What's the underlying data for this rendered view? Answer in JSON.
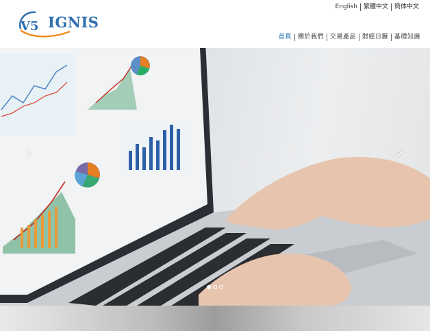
{
  "brand": {
    "logo_text": "IGNIS",
    "logo_mark": "V5"
  },
  "languages": [
    {
      "label": "English"
    },
    {
      "label": "繁體中文"
    },
    {
      "label": "簡体中文"
    }
  ],
  "nav": {
    "items": [
      {
        "label": "首頁",
        "active": true
      },
      {
        "label": "關於我們",
        "active": false
      },
      {
        "label": "交易產品",
        "active": false
      },
      {
        "label": "財經日曆",
        "active": false
      },
      {
        "label": "基礎知識",
        "active": false
      }
    ]
  },
  "carousel": {
    "prev_icon": "chevron-left-icon",
    "next_icon": "chevron-right-icon",
    "prev_glyph": "‹",
    "next_glyph": "›",
    "slide_count": 3,
    "active_slide": 1
  },
  "colors": {
    "accent": "#1b6fb3",
    "logo_blue": "#2d6fb0",
    "logo_orange": "#f28c1e"
  }
}
